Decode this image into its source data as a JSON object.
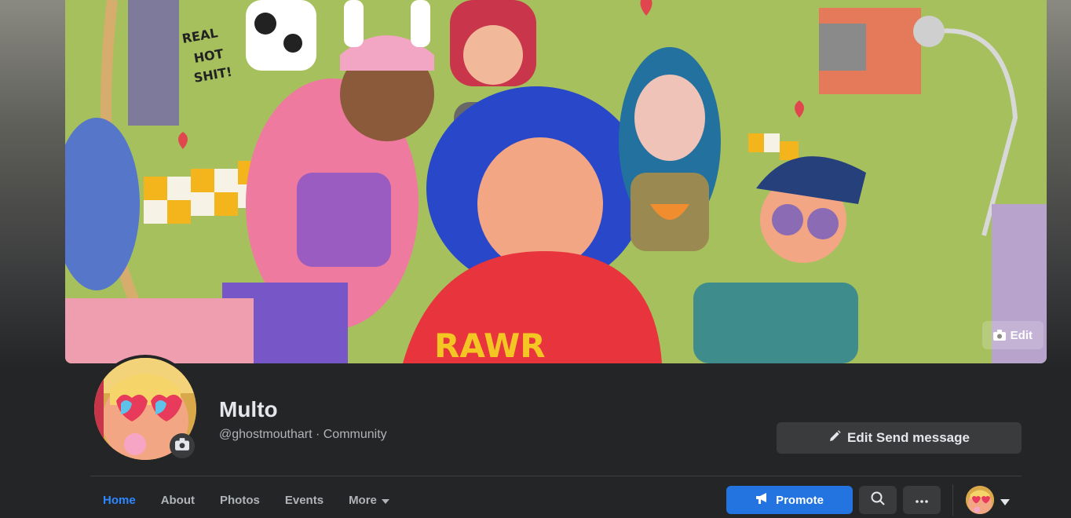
{
  "cover": {
    "edit_label": "Edit"
  },
  "profile": {
    "name": "Multo",
    "handle": "@ghostmouthart",
    "separator": " · ",
    "category": "Community"
  },
  "actions": {
    "edit_send_label": "Edit Send message"
  },
  "tabs": [
    {
      "label": "Home",
      "active": true
    },
    {
      "label": "About",
      "active": false
    },
    {
      "label": "Photos",
      "active": false
    },
    {
      "label": "Events",
      "active": false
    },
    {
      "label": "More",
      "active": false
    }
  ],
  "toolbar": {
    "promote_label": "Promote"
  },
  "colors": {
    "accent": "#2374e1",
    "active_tab": "#2d88ff",
    "background": "#242526",
    "button": "#3a3b3c"
  },
  "icons": [
    "camera-icon",
    "pencil-icon",
    "megaphone-icon",
    "search-icon",
    "more-icon",
    "chevron-down-icon"
  ]
}
